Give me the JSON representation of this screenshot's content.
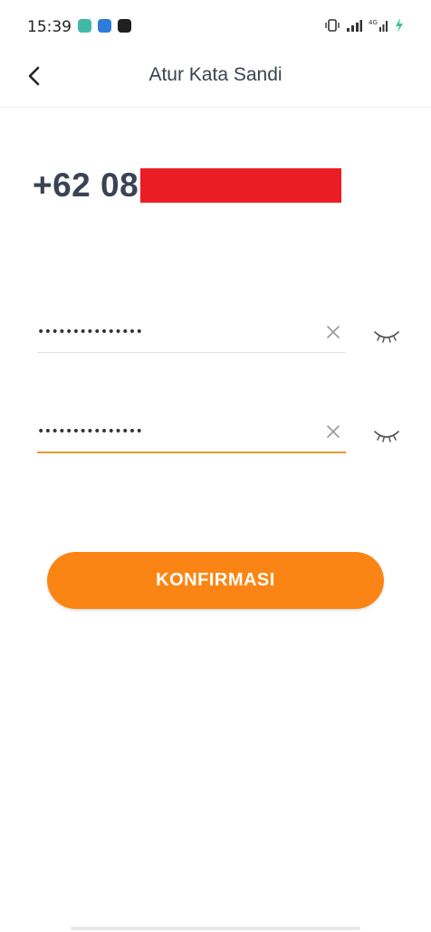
{
  "status_bar": {
    "time": "15:39",
    "notification_icons": [
      {
        "name": "chat-app-icon",
        "color": "#3fb8a8"
      },
      {
        "name": "messages-app-icon",
        "color": "#2f7bdc"
      },
      {
        "name": "task-app-icon",
        "color": "#1f1f1f"
      }
    ],
    "right_icons": [
      "vibrate-icon",
      "signal-icon",
      "network-4g-icon",
      "battery-charging-icon"
    ]
  },
  "header": {
    "title": "Atur Kata Sandi",
    "back_icon": "chevron-left-icon"
  },
  "phone": {
    "prefix": "+62 08",
    "redaction_color": "#ec1c24"
  },
  "fields": {
    "password": {
      "value": "•••••••••••••••",
      "clear_icon": "close-icon",
      "visibility_icon": "eye-closed-icon"
    },
    "confirm_password": {
      "value": "•••••••••••••••",
      "clear_icon": "close-icon",
      "visibility_icon": "eye-closed-icon",
      "focused": true
    }
  },
  "confirm_button": {
    "label": "KONFIRMASI",
    "color": "#fb8514"
  },
  "colors": {
    "accent_underline": "#e49a2d",
    "text_primary": "#394353"
  }
}
